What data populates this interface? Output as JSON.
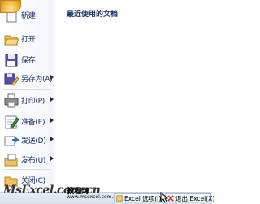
{
  "menu": {
    "recent_header": "最近使用的文档",
    "items": [
      {
        "label": "新建",
        "icon": "new-document-icon",
        "has_submenu": false
      },
      {
        "label": "打开",
        "icon": "open-folder-icon",
        "has_submenu": false
      },
      {
        "label": "保存",
        "icon": "save-floppy-icon",
        "has_submenu": false
      },
      {
        "label": "另存为(A)",
        "icon": "save-as-icon",
        "has_submenu": true
      },
      {
        "label": "打印(P)",
        "icon": "print-icon",
        "has_submenu": true
      },
      {
        "label": "准备(E)",
        "icon": "prepare-icon",
        "has_submenu": true
      },
      {
        "label": "发送(D)",
        "icon": "send-icon",
        "has_submenu": true
      },
      {
        "label": "发布(U)",
        "icon": "publish-icon",
        "has_submenu": true
      },
      {
        "label": "关闭(C)",
        "icon": "close-document-icon",
        "has_submenu": false
      }
    ]
  },
  "footer": {
    "options_button": "Excel 选项(I)",
    "exit_button": "退出 Excel(X)"
  },
  "watermark": {
    "text": "MsExcel.com.cn",
    "cn": "教程网",
    "sub": "www.msexcel.com.cn"
  }
}
